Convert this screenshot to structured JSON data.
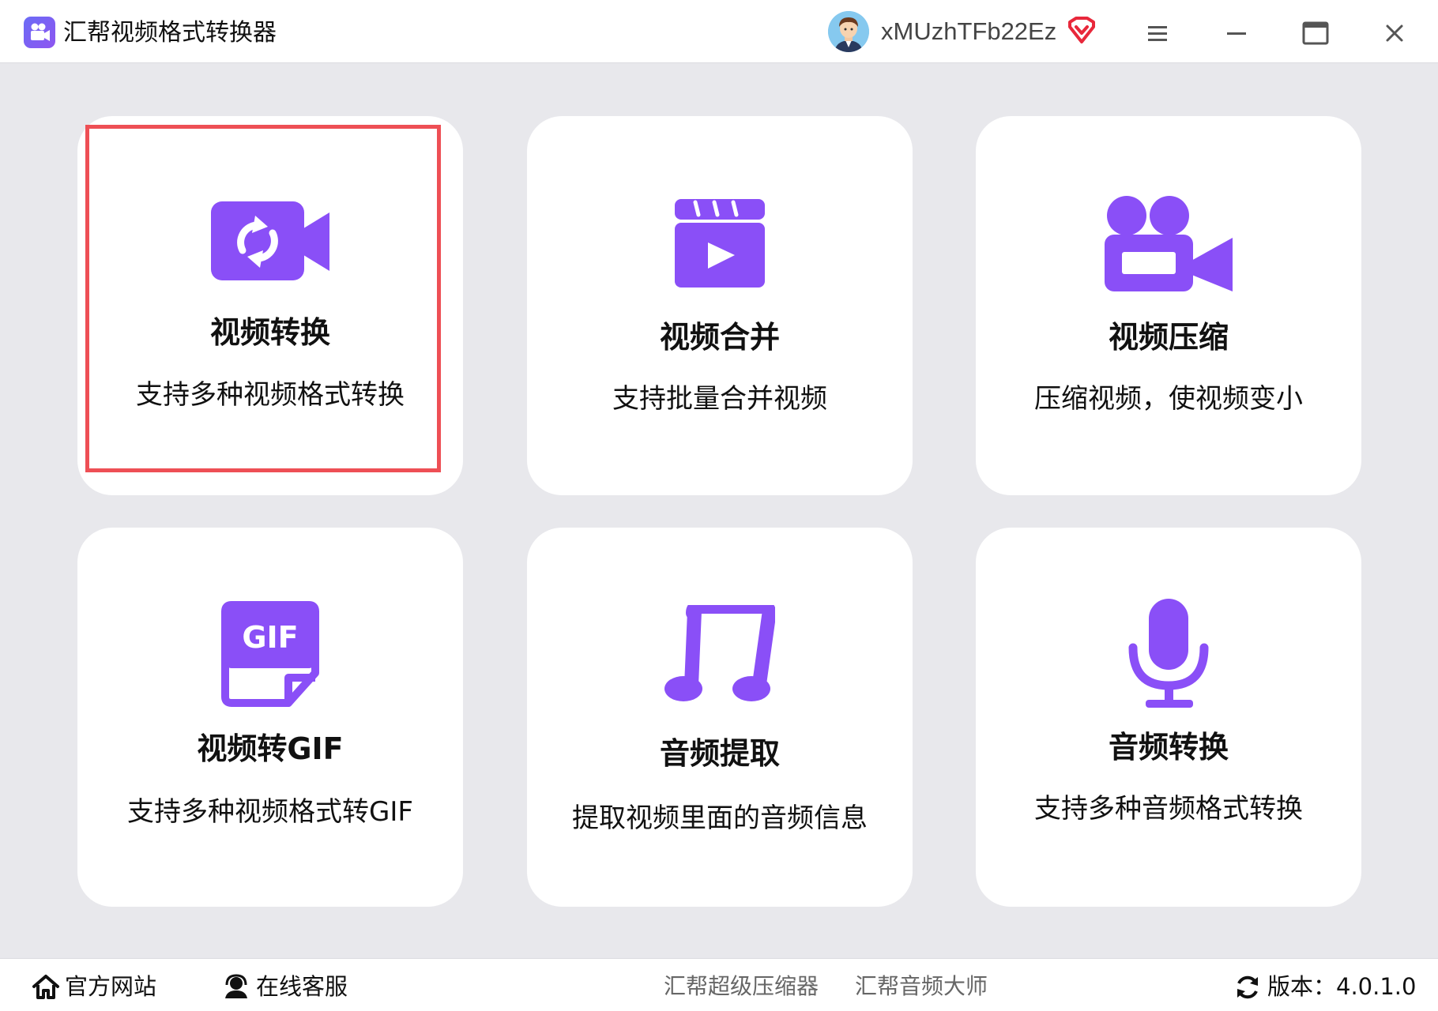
{
  "app": {
    "title": "汇帮视频格式转换器",
    "username": "xMUzhTFb22Ez"
  },
  "colors": {
    "accent": "#8a4ff7",
    "selected_border": "#ee4f55",
    "vip": "#e8283b"
  },
  "icons": {
    "menu": "menu-icon",
    "minimize": "minimize-icon",
    "maximize": "maximize-icon",
    "close": "close-icon"
  },
  "cards": [
    {
      "title": "视频转换",
      "desc": "支持多种视频格式转换",
      "icon": "video-convert-icon",
      "selected": true
    },
    {
      "title": "视频合并",
      "desc": "支持批量合并视频",
      "icon": "clapperboard-icon"
    },
    {
      "title": "视频压缩",
      "desc": "压缩视频，使视频变小",
      "icon": "video-camera-icon"
    },
    {
      "title": "视频转GIF",
      "desc": "支持多种视频格式转GIF",
      "icon": "gif-file-icon"
    },
    {
      "title": "音频提取",
      "desc": "提取视频里面的音频信息",
      "icon": "music-note-icon"
    },
    {
      "title": "音频转换",
      "desc": "支持多种音频格式转换",
      "icon": "microphone-icon"
    }
  ],
  "statusbar": {
    "website": "官方网站",
    "support": "在线客服",
    "link1": "汇帮超级压缩器",
    "link2": "汇帮音频大师",
    "version": "版本：4.0.1.0"
  }
}
